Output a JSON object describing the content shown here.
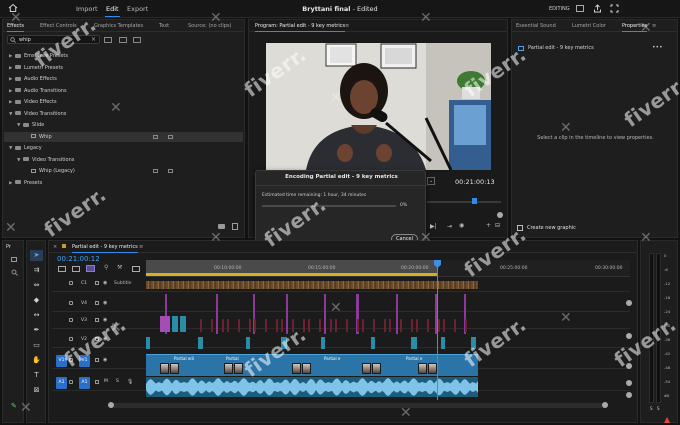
{
  "app": {
    "menu": [
      "Import",
      "Edit",
      "Export"
    ],
    "active_menu": "Edit",
    "title_bold": "Bryttani final",
    "title_rest": " - Edited",
    "workspace": "EDITING"
  },
  "effects_panel": {
    "tabs": [
      "Effects",
      "Effect Controls",
      "Graphics Templates",
      "Text",
      "Source: (no clips)"
    ],
    "active_tab": "Effects",
    "search_value": "whip",
    "tree": [
      {
        "label": "Ems' Free Presets",
        "depth": 0,
        "type": "folder",
        "open": false
      },
      {
        "label": "Lumetri Presets",
        "depth": 0,
        "type": "folder",
        "open": false
      },
      {
        "label": "Audio Effects",
        "depth": 0,
        "type": "folder",
        "open": false
      },
      {
        "label": "Audio Transitions",
        "depth": 0,
        "type": "folder",
        "open": false
      },
      {
        "label": "Video Effects",
        "depth": 0,
        "type": "folder",
        "open": false
      },
      {
        "label": "Video Transitions",
        "depth": 0,
        "type": "folder",
        "open": true
      },
      {
        "label": "Slide",
        "depth": 1,
        "type": "folder",
        "open": true
      },
      {
        "label": "Whip",
        "depth": 2,
        "type": "effect",
        "selected": true
      },
      {
        "label": "Legacy",
        "depth": 0,
        "type": "folder",
        "open": true
      },
      {
        "label": "Video Transitions",
        "depth": 1,
        "type": "folder",
        "open": true
      },
      {
        "label": "Whip (Legacy)",
        "depth": 2,
        "type": "effect"
      },
      {
        "label": "Presets",
        "depth": 0,
        "type": "folder",
        "open": false
      }
    ]
  },
  "program_monitor": {
    "tab": "Program: Partial edit - 9 key metrics",
    "timecode": "00:21:00:13"
  },
  "encoding_dialog": {
    "title": "Encoding Partial edit - 9 key metrics",
    "estimate": "Estimated time remaining: 1 hour, 34 minutes",
    "percent": "0%",
    "progress": 0.0,
    "cancel_label": "Cancel"
  },
  "right_panel": {
    "tabs": [
      "Essential Sound",
      "Lumetri Color",
      "Properties"
    ],
    "active_tab": "Properties",
    "clip_name": "Partial edit - 9 key metrics",
    "empty_message": "Select a clip in the timeline to view properties.",
    "create_graphic": "Create new graphic"
  },
  "project_panel": {
    "tab": "Pr"
  },
  "timeline": {
    "tab": "Partial edit - 9 key metrics",
    "timecode": "00:21:00:12",
    "ruler": [
      "00:10:00:00",
      "00:15:00:00",
      "00:20:00:00",
      "00:25:00:00",
      "00:30:00:00"
    ],
    "tracks": [
      {
        "label": "C1",
        "sub": "Subtitle"
      },
      {
        "label": "V4"
      },
      {
        "label": "V3"
      },
      {
        "label": "V2"
      },
      {
        "label": "V1",
        "source": "V1"
      },
      {
        "label": "A1",
        "source": "A1"
      }
    ],
    "clip_labels": [
      "Partial edi",
      "Partial",
      "Partial e",
      "Partial e"
    ],
    "audio_meter_labels": [
      "0",
      "-6",
      "-12",
      "-18",
      "-24",
      "-30",
      "-36",
      "-42",
      "-48",
      "-54",
      "dB"
    ],
    "audio_meter_bottom": [
      "S",
      "S"
    ]
  },
  "watermark": "fiverr."
}
